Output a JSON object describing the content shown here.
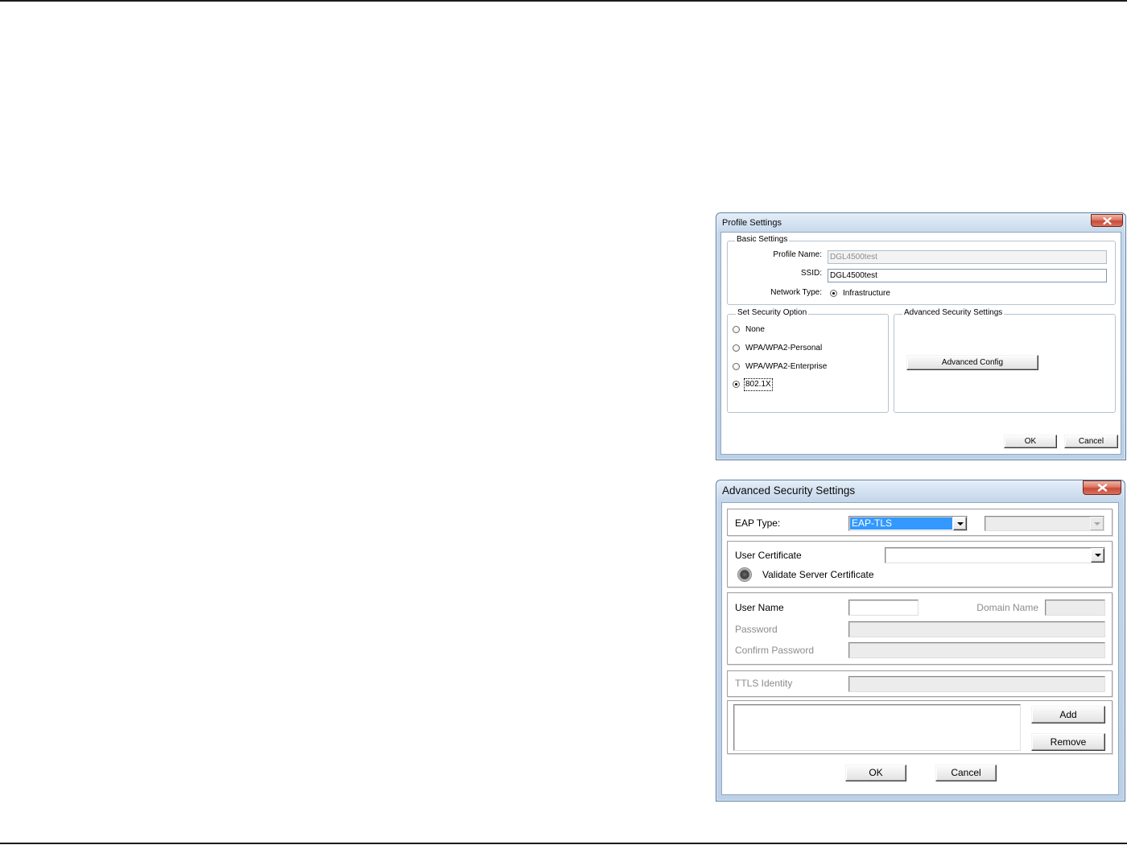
{
  "profile_dialog": {
    "title": "Profile Settings",
    "basic_settings": {
      "legend": "Basic Settings",
      "profile_name": {
        "label": "Profile Name:",
        "value": "DGL4500test",
        "disabled": true
      },
      "ssid": {
        "label": "SSID:",
        "value": "DGL4500test"
      },
      "network_type": {
        "label": "Network Type:",
        "option": "Infrastructure",
        "selected": true
      }
    },
    "security_option": {
      "legend": "Set Security Option",
      "options": [
        {
          "label": "None",
          "selected": false
        },
        {
          "label": "WPA/WPA2-Personal",
          "selected": false
        },
        {
          "label": "WPA/WPA2-Enterprise",
          "selected": false
        },
        {
          "label": "802.1X",
          "selected": true,
          "focused": true
        }
      ]
    },
    "advanced_security": {
      "legend": "Advanced Security Settings",
      "config_button": "Advanced Config"
    },
    "buttons": {
      "ok": "OK",
      "cancel": "Cancel"
    }
  },
  "advanced_dialog": {
    "title": "Advanced Security Settings",
    "eap_type": {
      "label": "EAP Type:",
      "value": "EAP-TLS",
      "highlighted": true,
      "inner_method": {
        "value": "",
        "disabled": true
      }
    },
    "user_certificate": {
      "label": "User Certificate",
      "value": ""
    },
    "validate_server_certificate": {
      "label": "Validate Server Certificate"
    },
    "user_name": {
      "label": "User Name",
      "value": ""
    },
    "domain_name": {
      "label": "Domain Name",
      "value": "",
      "disabled": true
    },
    "password": {
      "label": "Password",
      "value": "",
      "disabled": true
    },
    "confirm_password": {
      "label": "Confirm Password",
      "value": "",
      "disabled": true
    },
    "ttls_identity": {
      "label": "TTLS Identity",
      "value": "",
      "disabled": true
    },
    "list_items": [],
    "buttons": {
      "add": "Add",
      "remove": "Remove",
      "ok": "OK",
      "cancel": "Cancel"
    }
  },
  "icons": {
    "close": "close-icon",
    "dropdown": "chevron-down-icon",
    "radio": "radio-icon"
  },
  "colors": {
    "selection_bg": "#3399ff",
    "selection_text": "#ffffff",
    "close_button": "#c9493a",
    "disabled_text": "#8c8c8c",
    "window_frame": "#c4d6ea"
  }
}
